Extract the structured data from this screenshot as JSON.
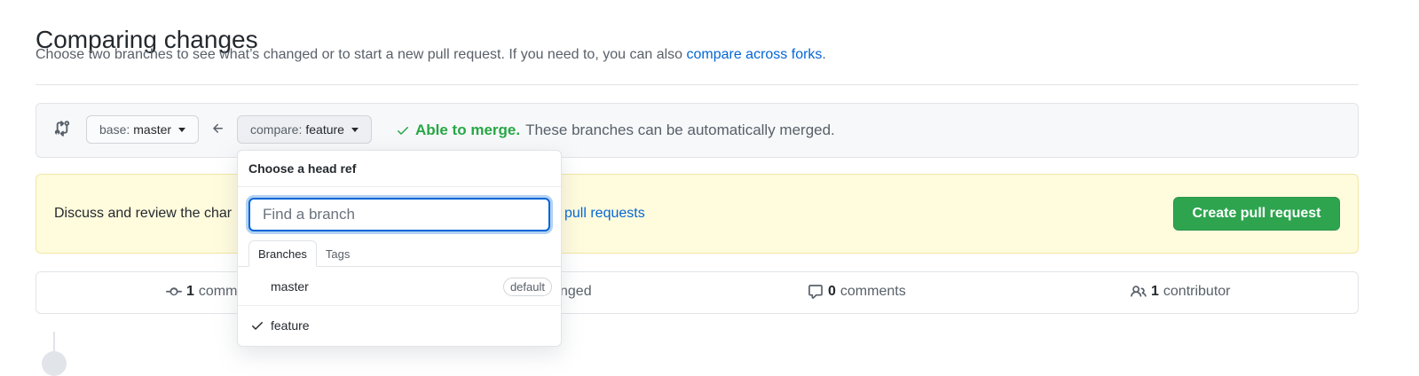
{
  "page": {
    "title": "Comparing changes",
    "subtitle_text": "Choose two branches to see what’s changed or to start a new pull request. If you need to, you can also ",
    "subtitle_link": "compare across forks",
    "subtitle_end": "."
  },
  "range": {
    "base_prefix": "base:",
    "base_ref": "master",
    "compare_prefix": "compare:",
    "compare_ref": "feature",
    "merge_ok": "Able to merge.",
    "merge_detail": "These branches can be automatically merged."
  },
  "flash": {
    "text": "Discuss and review the char",
    "link": "pull requests",
    "create_button": "Create pull request"
  },
  "stats": {
    "commits_count": "1",
    "commits_label": "comm",
    "files_label": "nged",
    "comments_count": "0",
    "comments_label": "comments",
    "contributors_count": "1",
    "contributors_label": "contributor"
  },
  "dropdown": {
    "header": "Choose a head ref",
    "search_placeholder": "Find a branch",
    "tabs": [
      "Branches",
      "Tags"
    ],
    "items": [
      {
        "name": "master",
        "badge": "default",
        "selected": false
      },
      {
        "name": "feature",
        "badge": "",
        "selected": true
      }
    ]
  },
  "colors": {
    "accent_link": "#0366d6",
    "success": "#28a745",
    "create_button": "#2ea44f",
    "flash_bg": "#fffbdd"
  },
  "icons": [
    "git-compare-icon",
    "caret-down-icon",
    "arrow-left-icon",
    "check-icon",
    "commit-icon",
    "comment-icon",
    "people-icon"
  ]
}
